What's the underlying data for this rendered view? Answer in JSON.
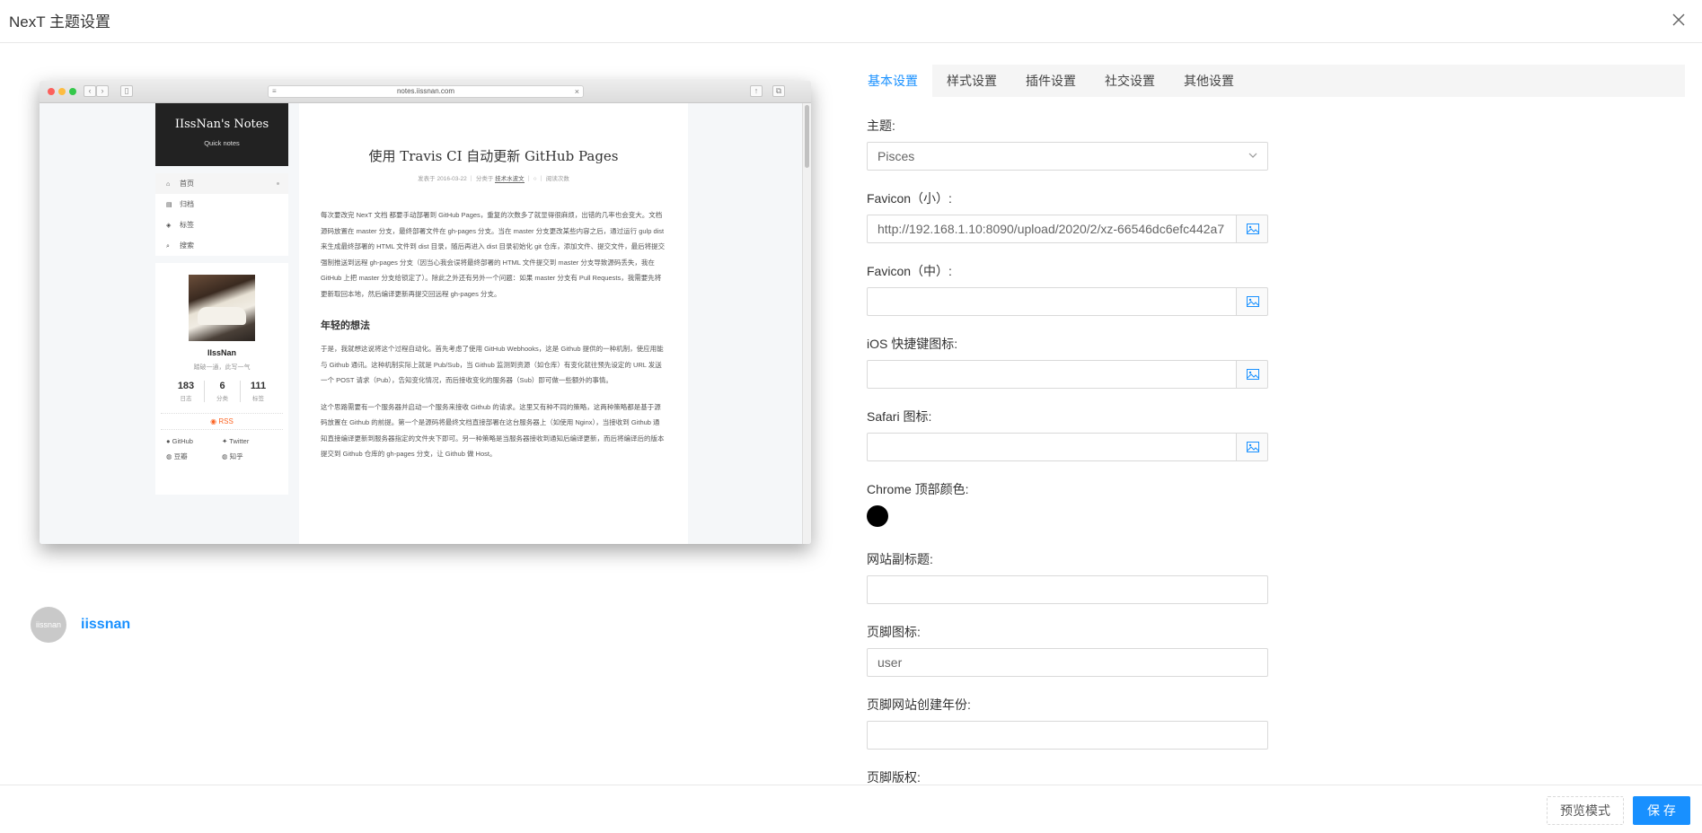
{
  "modal": {
    "title": "NexT 主题设置"
  },
  "preview": {
    "url": "notes.iissnan.com",
    "site_title": "IIssNan's Notes",
    "site_subtitle": "Quick notes",
    "menu": [
      "首页",
      "归档",
      "标签",
      "搜索"
    ],
    "author": "IIssNan",
    "author_desc": "踏破一通，此写一气",
    "stats": [
      {
        "num": "183",
        "label": "日志"
      },
      {
        "num": "6",
        "label": "分类"
      },
      {
        "num": "111",
        "label": "标签"
      }
    ],
    "rss": "RSS",
    "links": [
      "GitHub",
      "Twitter",
      "豆瓣",
      "知乎"
    ],
    "post_title": "使用 Travis CI 自动更新 GitHub Pages",
    "post_meta": "发表于 2016-03-22 ｜ 分类于",
    "post_meta_cat": "技术水波文",
    "post_meta_end": "｜ ○ ｜ 阅读次数",
    "para1": "每次要改完 NexT 文档 都要手动部署到 GitHub Pages，重复的次数多了就显得很麻烦，出错的几率也会变大。文档源码放置在 master 分支，最终部署文件在 gh-pages 分支。当在 master 分支更改某些内容之后，通过运行 gulp dist 来生成最终部署的 HTML 文件到 dist 目录，随后再进入 dist 目录初始化 git 仓库，添加文件、提交文件，最后将提交强制推送到远程 gh-pages 分支（因当心我会误将最终部署的 HTML 文件提交到 master 分支导致源码丢失，我在 GitHub 上把 master 分支给锁定了）。除此之外还有另外一个问题：如果 master 分支有 Pull Requests，我需要先将更新取回本地，然后编译更新再提交回远程 gh-pages 分支。",
    "h2": "年轻的想法",
    "para2": "于是，我就想这说将这个过程自动化。首先考虑了使用 GitHub Webhooks，这是 Github 提供的一种机制，使应用能与 Github 通讯。这种机制实际上就是 Pub/Sub，当 Github 监测到资源（如仓库）有变化就往预先设定的 URL 发送一个 POST 请求（Pub），告知变化情况，而后接收变化的服务器（Sub）即可做一些额外的事情。",
    "para3": "这个思路需要有一个服务器并启动一个服务来接收 Github 的请求。这里又有种不同的策略，这两种策略都是基于源码放置在 Github 的前提。第一个是源码将最终文档直接部署在这台服务器上（如使用 Nginx），当接收到 Github 通知直接编译更新到服务器指定的文件夹下即可。另一种策略是当服务器接收到通知后编译更新，而后将编译后的版本提交到 Github 仓库的 gh-pages 分支，让 Github 做 Host。"
  },
  "user": {
    "avatar_text": "iissnan",
    "name": "iissnan"
  },
  "tabs": [
    "基本设置",
    "样式设置",
    "插件设置",
    "社交设置",
    "其他设置"
  ],
  "form": {
    "theme_label": "主题:",
    "theme_value": "Pisces",
    "favicon_small_label": "Favicon（小）:",
    "favicon_small_value": "http://192.168.1.10:8090/upload/2020/2/xz-66546dc6efc442a7",
    "favicon_medium_label": "Favicon（中）:",
    "favicon_medium_value": "",
    "ios_icon_label": "iOS 快捷键图标:",
    "ios_icon_value": "",
    "safari_icon_label": "Safari 图标:",
    "safari_icon_value": "",
    "chrome_color_label": "Chrome 顶部颜色:",
    "chrome_color_value": "#000000",
    "subtitle_label": "网站副标题:",
    "subtitle_value": "",
    "footer_icon_label": "页脚图标:",
    "footer_icon_value": "user",
    "footer_year_label": "页脚网站创建年份:",
    "footer_year_value": "",
    "footer_copyright_label": "页脚版权:"
  },
  "footer": {
    "preview_label": "预览模式",
    "save_label": "保 存"
  },
  "colors": {
    "accent": "#1890ff",
    "rss": "#fc6423"
  }
}
